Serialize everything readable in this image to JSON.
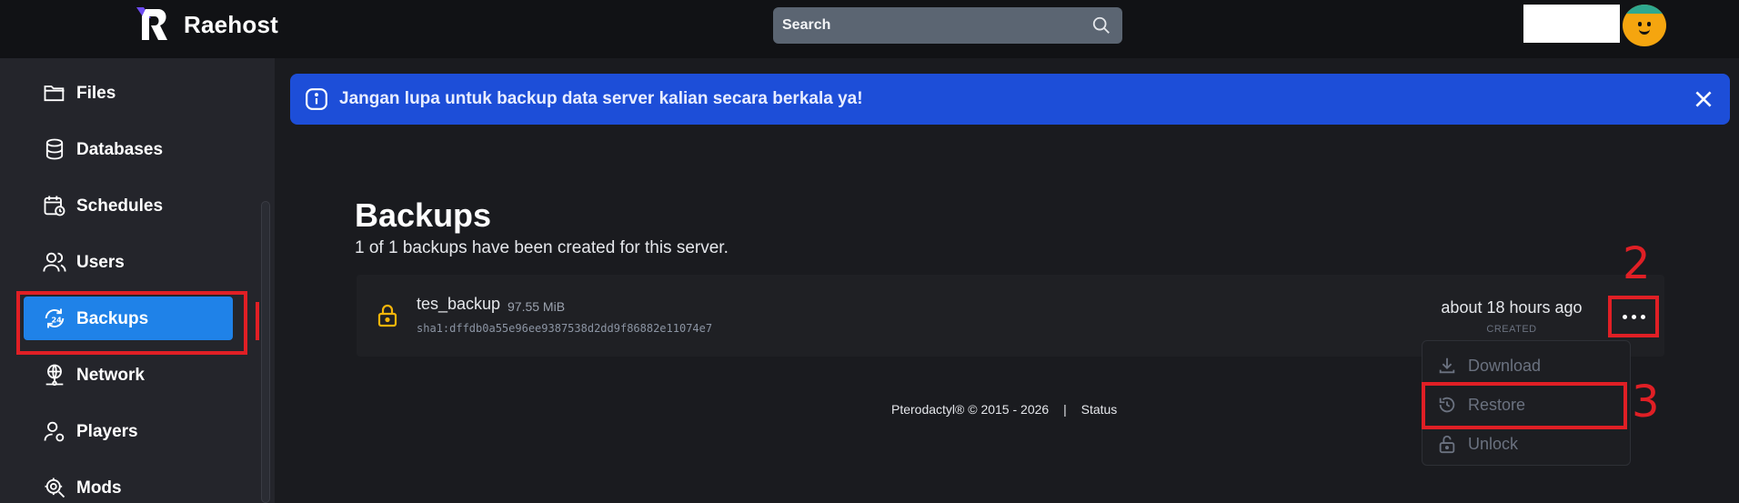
{
  "header": {
    "brand": "Raehost",
    "search_placeholder": "Search"
  },
  "sidebar": {
    "items": [
      {
        "label": "Files",
        "icon": "folder-icon"
      },
      {
        "label": "Databases",
        "icon": "database-icon"
      },
      {
        "label": "Schedules",
        "icon": "calendar-clock-icon"
      },
      {
        "label": "Users",
        "icon": "users-icon"
      },
      {
        "label": "Backups",
        "icon": "backup-24-icon",
        "active": true
      },
      {
        "label": "Network",
        "icon": "network-icon"
      },
      {
        "label": "Players",
        "icon": "user-gear-icon"
      },
      {
        "label": "Mods",
        "icon": "cog-search-icon"
      }
    ]
  },
  "banner": {
    "text": "Jangan lupa untuk backup data server kalian secara berkala ya!"
  },
  "main": {
    "title": "Backups",
    "subtitle": "1 of 1 backups have been created for this server.",
    "backups": [
      {
        "name": "tes_backup",
        "size": "97.55 MiB",
        "hash": "sha1:dffdb0a55e96ee9387538d2dd9f86882e11074e7",
        "time": "about 18 hours ago",
        "time_label": "CREATED"
      }
    ]
  },
  "menu": {
    "download": "Download",
    "restore": "Restore",
    "unlock": "Unlock"
  },
  "annotations": {
    "two": "2",
    "three": "3"
  },
  "footer": {
    "copyright": "Pterodactyl® © 2015 - 2026",
    "separator": "|",
    "status": "Status"
  },
  "colors": {
    "accent": "#1f82e8",
    "banner": "#1d4ed8",
    "annotation": "#e01f25",
    "lock": "#f5b50a"
  }
}
